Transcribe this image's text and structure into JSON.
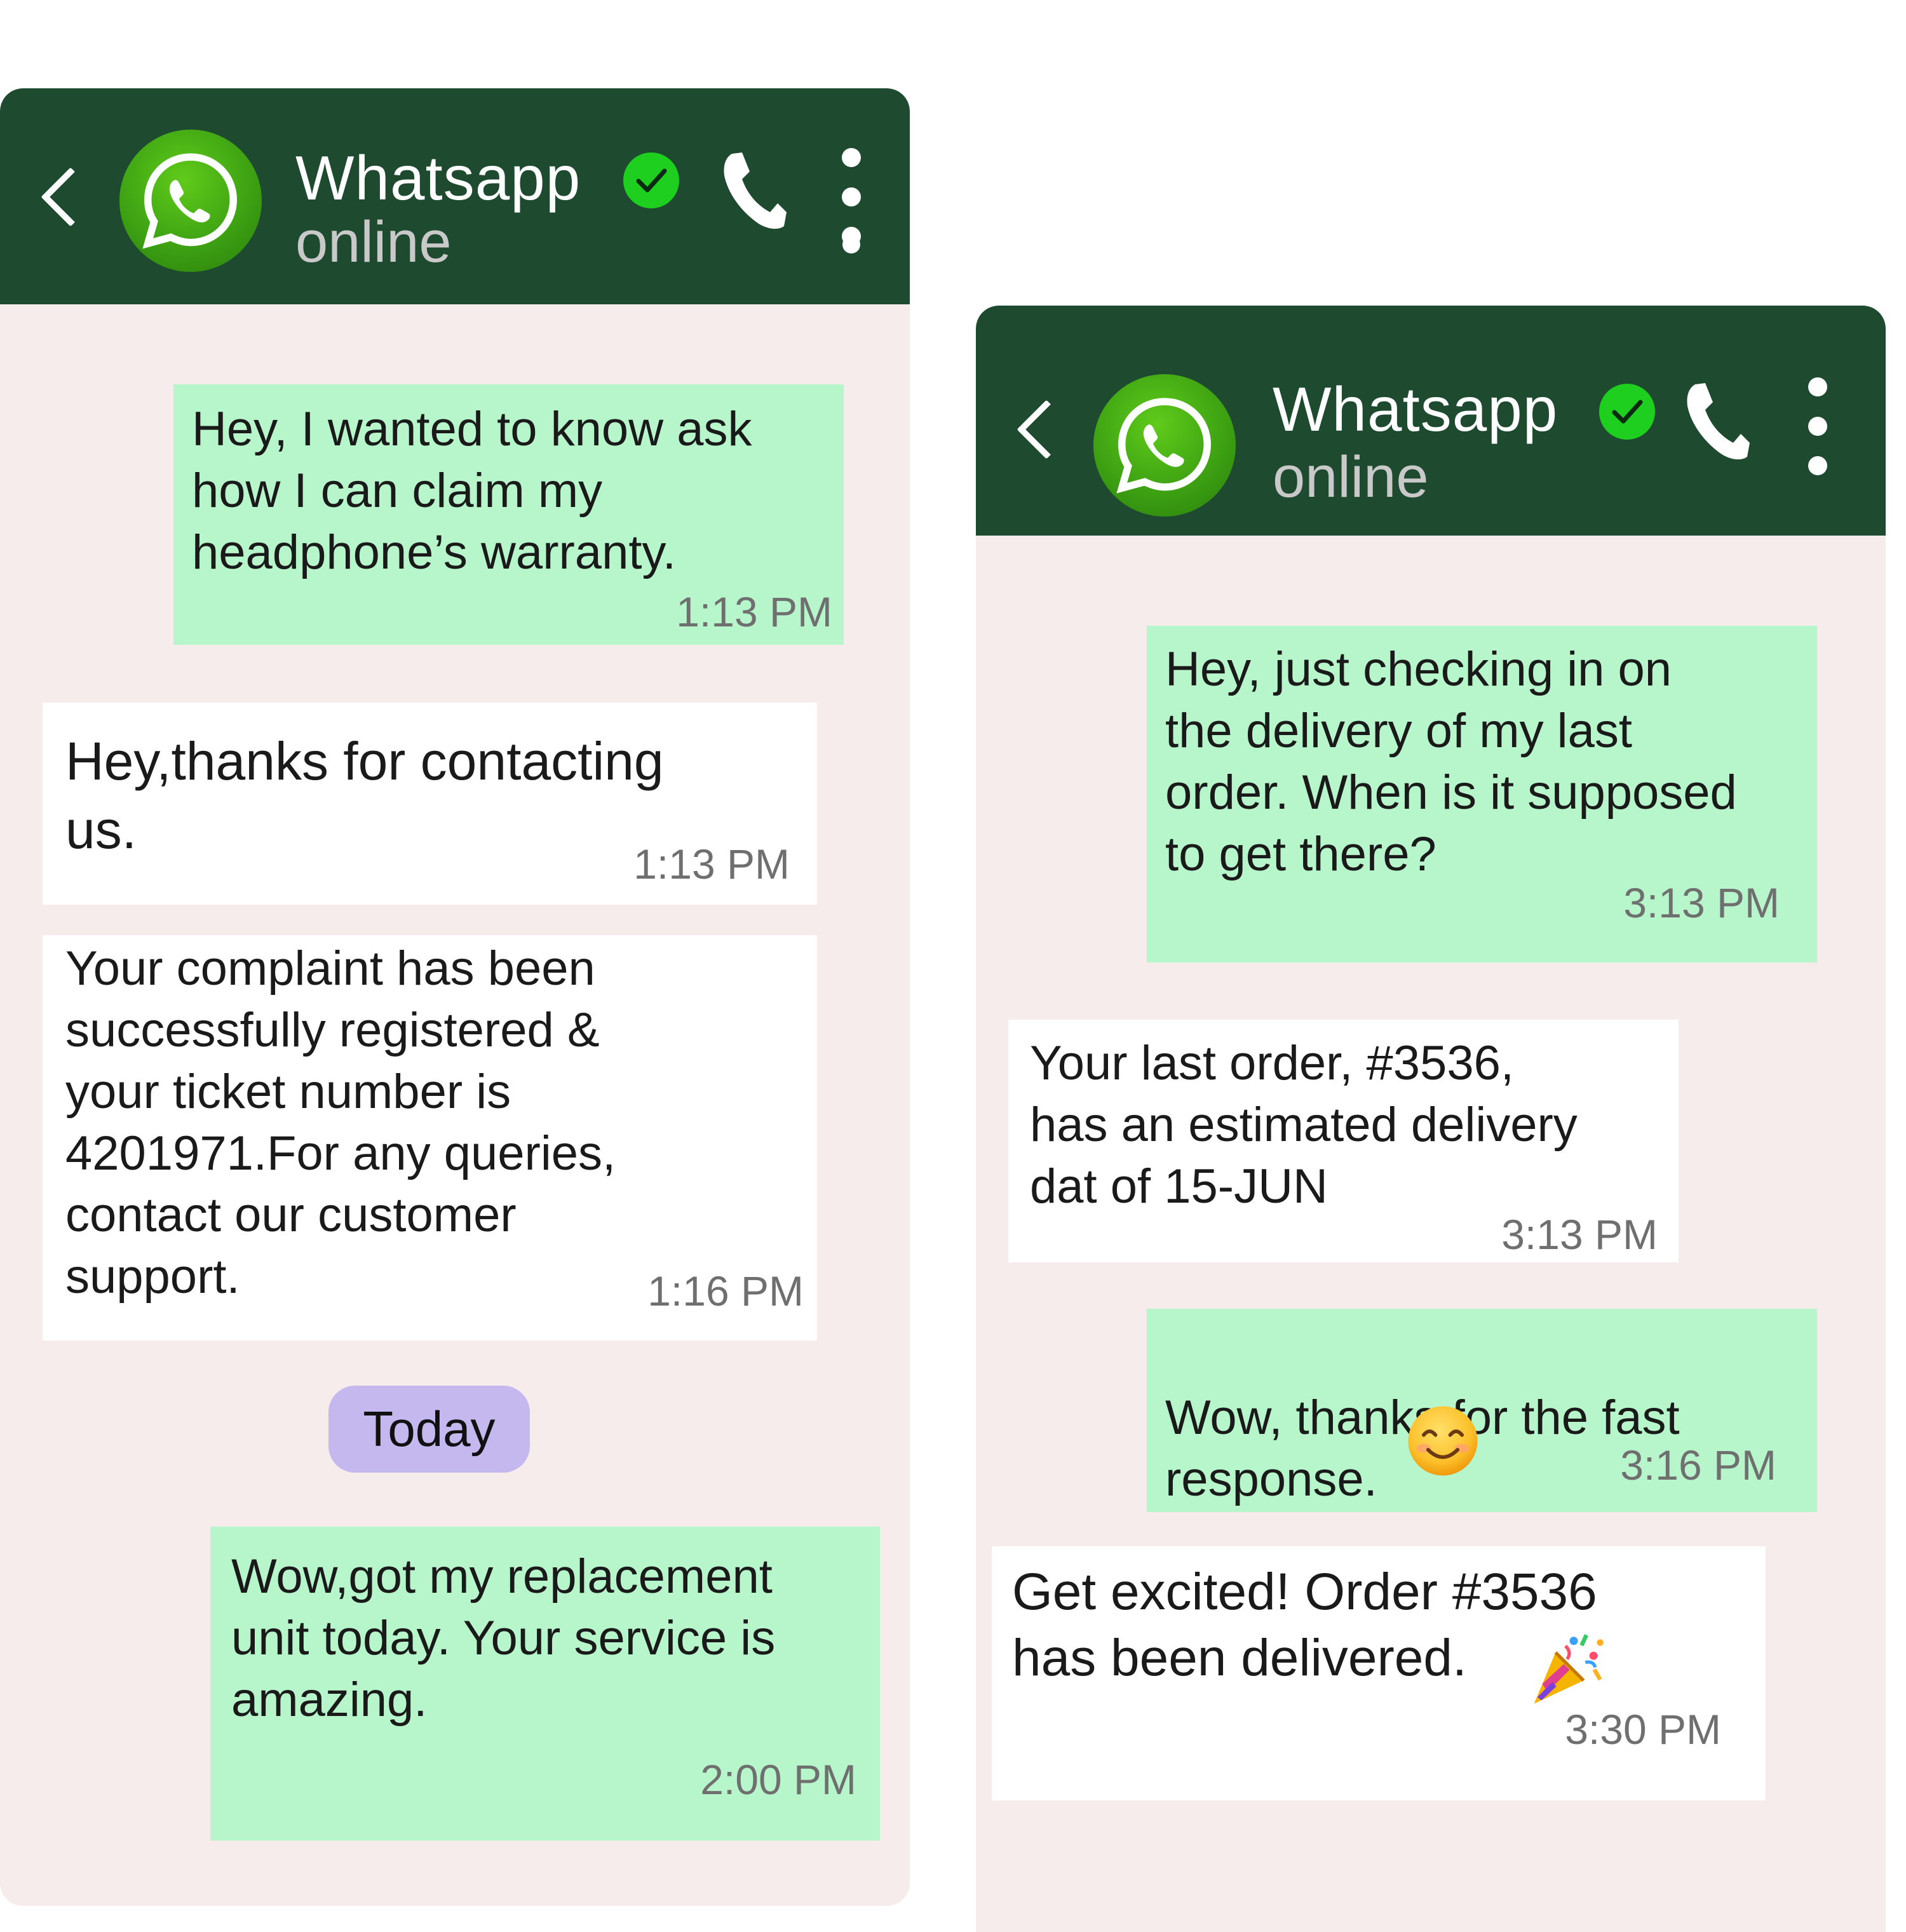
{
  "colors": {
    "header": "#1e4a30",
    "chat_background": "#f7ecec",
    "outgoing_bubble": "#b7f5cb",
    "incoming_bubble": "#ffffff",
    "date_chip": "#c4b8ee",
    "verified_badge": "#1fcf1f"
  },
  "chats": [
    {
      "header": {
        "back_icon": "chevron-left-icon",
        "avatar_icon": "whatsapp-logo-icon",
        "contact_name": "Whatsapp",
        "verified_icon": "verified-check-icon",
        "status": "online",
        "call_icon": "phone-icon",
        "menu_icon": "more-vertical-icon"
      },
      "messages": [
        {
          "direction": "outgoing",
          "text": "Hey, I wanted to know ask\nhow I can claim my\nheadphone’s warranty.",
          "time": "1:13 PM"
        },
        {
          "direction": "incoming",
          "text": "Hey,thanks for contacting\nus.",
          "time": "1:13 PM"
        },
        {
          "direction": "incoming",
          "text": "Your complaint has been\nsuccessfully registered &\nyour ticket number is\n4201971.For any queries,\ncontact our customer\nsupport.",
          "time": "1:16 PM"
        },
        {
          "direction": "outgoing",
          "text": "Wow,got my replacement\nunit today. Your service is\namazing.",
          "time": "2:00 PM"
        }
      ],
      "date_separator": "Today"
    },
    {
      "header": {
        "back_icon": "chevron-left-icon",
        "avatar_icon": "whatsapp-logo-icon",
        "contact_name": "Whatsapp",
        "verified_icon": "verified-check-icon",
        "status": "online",
        "call_icon": "phone-icon",
        "menu_icon": "more-vertical-icon"
      },
      "messages": [
        {
          "direction": "outgoing",
          "text": "Hey, just checking in on\nthe delivery of my last\norder. When is it supposed\nto get there?",
          "time": "3:13 PM"
        },
        {
          "direction": "incoming",
          "text": "Your last order, #3536,\nhas an estimated delivery\ndat of 15-JUN",
          "time": "3:13 PM"
        },
        {
          "direction": "outgoing",
          "text": "Wow, thanks for the fast\nresponse.",
          "emoji": "smiling-face-emoji",
          "time": "3:16 PM"
        },
        {
          "direction": "incoming",
          "text": "Get excited! Order #3536\nhas been delivered.",
          "emoji": "party-popper-emoji",
          "time": "3:30 PM"
        }
      ]
    }
  ]
}
